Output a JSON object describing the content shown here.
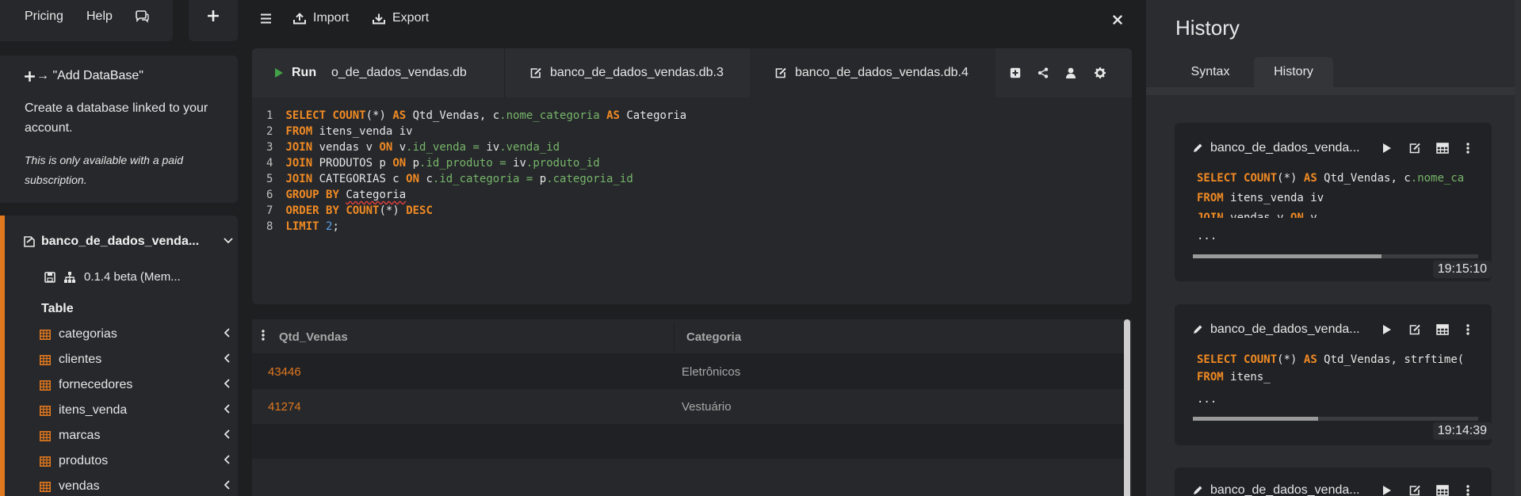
{
  "topnav": {
    "pricing": "Pricing",
    "help": "Help"
  },
  "add_db": {
    "title": "→ \"Add DataBase\"",
    "description": "Create a database linked to your account.",
    "note": "This is only available with a paid subscription."
  },
  "database": {
    "name": "banco_de_dados_venda...",
    "version": "0.1.4 beta (Mem...",
    "table_header": "Table",
    "tables": [
      "categorias",
      "clientes",
      "fornecedores",
      "itens_venda",
      "marcas",
      "produtos",
      "vendas"
    ]
  },
  "toolbar": {
    "import_label": "Import",
    "export_label": "Export"
  },
  "tabs": [
    {
      "label": "Run"
    },
    {
      "label": "o_de_dados_vendas.db"
    },
    {
      "label": "banco_de_dados_vendas.db.3"
    },
    {
      "label": "banco_de_dados_vendas.db.4"
    }
  ],
  "results": {
    "columns": [
      "Qtd_Vendas",
      "Categoria"
    ],
    "rows": [
      [
        "43446",
        "Eletrônicos"
      ],
      [
        "41274",
        "Vestuário"
      ]
    ]
  },
  "history": {
    "title": "History",
    "tabs": {
      "syntax": "Syntax",
      "history": "History"
    },
    "items": [
      {
        "name": "banco_de_dados_venda...",
        "time": "19:15:10",
        "progress": 0.66
      },
      {
        "name": "banco_de_dados_venda...",
        "time": "19:14:39",
        "progress": 0.44
      },
      {
        "name": "banco_de_dados_venda..."
      }
    ]
  },
  "colors": {
    "accent": "#e0781f",
    "keyword": "#f08a24",
    "column": "#77b56a",
    "number": "#5ea1e6",
    "run": "#43a047"
  }
}
